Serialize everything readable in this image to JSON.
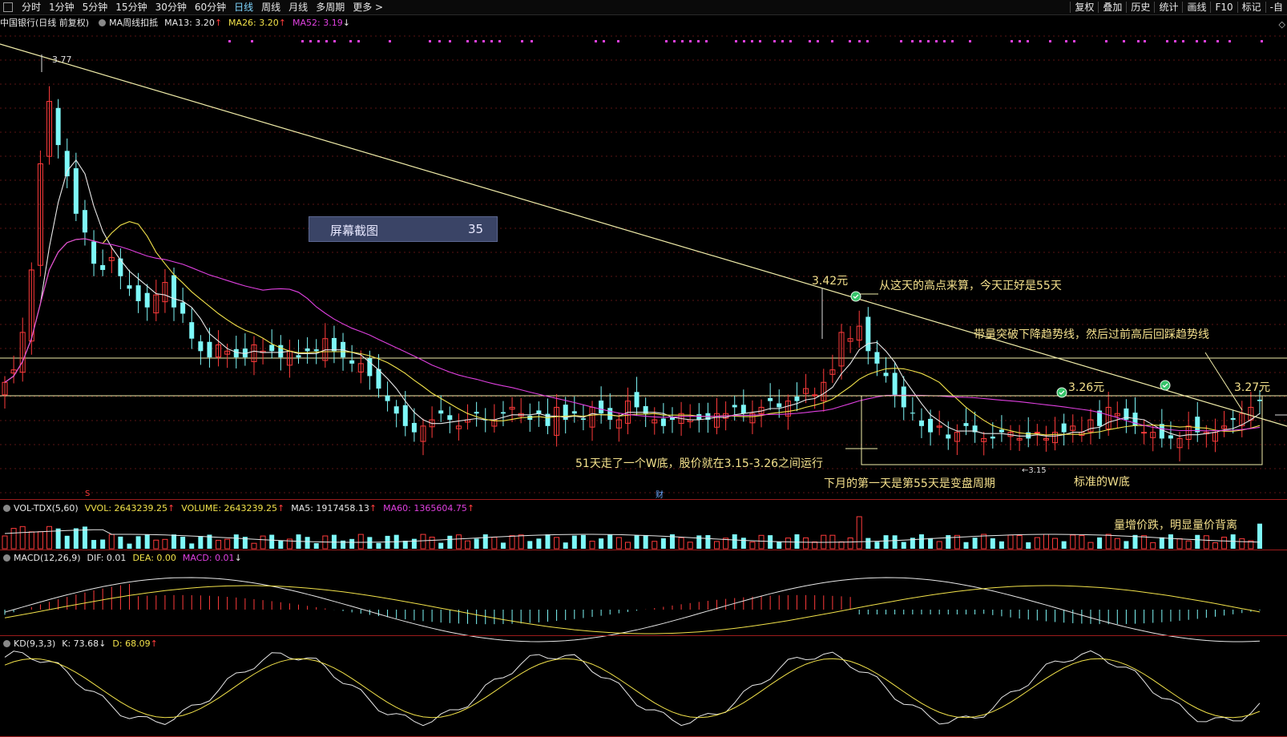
{
  "toolbar": {
    "periods": [
      "分时",
      "1分钟",
      "5分钟",
      "15分钟",
      "30分钟",
      "60分钟",
      "日线",
      "周线",
      "月线",
      "多周期",
      "更多 >"
    ],
    "active_period": "日线",
    "tools": [
      "复权",
      "叠加",
      "历史",
      "统计",
      "画线",
      "F10",
      "标记",
      "-自"
    ]
  },
  "main_legend": {
    "title": "中国银行(日线 前复权)",
    "indicator": "MA周线扣抵",
    "ma13": "MA13: 3.20",
    "ma26": "MA26: 3.20",
    "ma52": "MA52: 3.19"
  },
  "vol_legend": {
    "name": "VOL-TDX(5,60)",
    "vvol": "VVOL: 2643239.25",
    "volume": "VOLUME: 2643239.25",
    "ma5": "MA5: 1917458.13",
    "ma60": "MA60: 1365604.75"
  },
  "macd_legend": {
    "name": "MACD(12,26,9)",
    "dif": "DIF: 0.01",
    "dea": "DEA: 0.00",
    "macd": "MACD: 0.01"
  },
  "kd_legend": {
    "name": "KD(9,3,3)",
    "k": "K: 73.68",
    "d": "D: 68.09"
  },
  "screenshot_badge": {
    "label": "屏幕截图",
    "count": "35"
  },
  "annotations": {
    "high_377": "3.77",
    "price_342": "3.42元",
    "note_55days": "从这天的高点来算，今天正好是55天",
    "note_breakout": "带量突破下降趋势线，然后过前高后回踩趋势线",
    "price_326": "3.26元",
    "price_327": "3.27元",
    "note_wbottom": "51天走了一个W底，股价就在3.15-3.26之间运行",
    "note_cycle": "下月的第一天是第55天是变盘周期",
    "note_standard": "标准的W底",
    "low_315": "←3.15",
    "note_volume": "量增价跌，明显量价背离",
    "s_marker": "S",
    "cai_marker": "财"
  },
  "colors": {
    "up": "#ff3b3b",
    "down": "#7ef8f8",
    "ma13": "#e8e8e8",
    "ma26": "#f2e24a",
    "ma52": "#e040e0",
    "trend": "#f2eeaa",
    "annotation": "#f4e08c",
    "badge_bg": "#3a4466",
    "divider": "#9b1c1c"
  },
  "icons": [
    "check-circle-icon",
    "window-icon"
  ]
}
